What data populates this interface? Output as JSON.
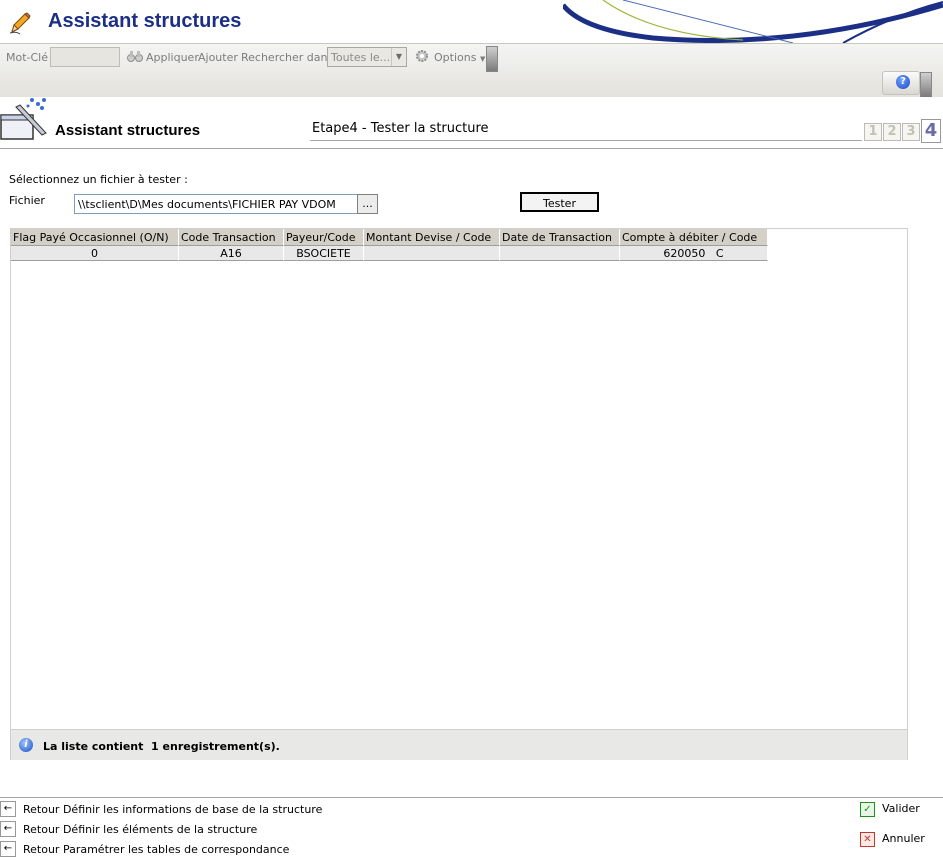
{
  "app": {
    "title": "Assistant structures"
  },
  "toolbar": {
    "keyword_label": "Mot-Clé",
    "apply_label": "Appliquer",
    "add_label": "Ajouter",
    "search_in_label": "Rechercher dans",
    "search_in_value": "Toutes le...",
    "options_label": "Options"
  },
  "wizard": {
    "title": "Assistant structures",
    "step_title": "Etape4 - Tester la structure",
    "steps": [
      "1",
      "2",
      "3",
      "4"
    ],
    "current_step": 4
  },
  "form": {
    "select_prompt": "Sélectionnez un fichier à tester :",
    "file_label": "Fichier",
    "file_value": "\\\\tsclient\\D\\Mes documents\\FICHIER PAY VDOM",
    "browse_label": "...",
    "test_button": "Tester"
  },
  "grid": {
    "columns": [
      "Flag Payé Occasionnel (O/N)",
      "Code Transaction",
      "Payeur/Code",
      "Montant Devise / Code",
      "Date de Transaction",
      "Compte à débiter / Code"
    ],
    "rows": [
      [
        "0",
        "A16",
        "BSOCIETE",
        "",
        "",
        "620050   C"
      ]
    ],
    "footer_text": "La liste contient  1 enregistrement(s)."
  },
  "nav": {
    "links": [
      "Retour Définir les informations de base de la structure",
      "Retour Définir les éléments de la structure",
      "Retour Paramétrer les tables de correspondance"
    ]
  },
  "actions": {
    "validate": "Valider",
    "cancel": "Annuler"
  },
  "colors": {
    "title_blue": "#1c2f86",
    "header_gray": "#d4d0c8",
    "validate_green": "#1f8f1f",
    "cancel_red": "#c0392b"
  }
}
